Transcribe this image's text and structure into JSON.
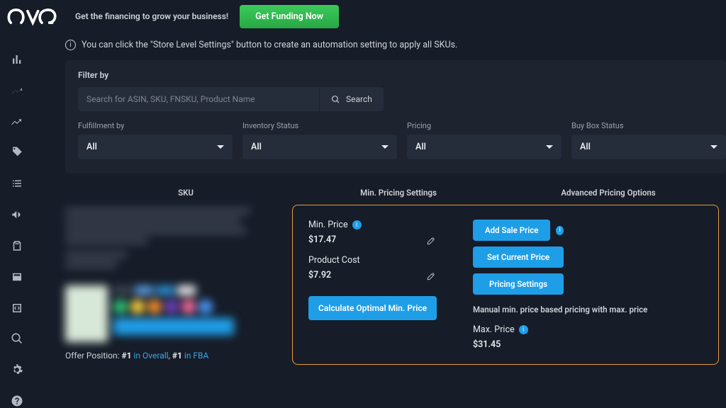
{
  "topbar": {
    "promo_text": "Get the financing to grow your business!",
    "funding_btn": "Get Funding Now"
  },
  "info_banner": "You can click the \"Store Level Settings\" button to create an automation setting to apply all SKUs.",
  "filter": {
    "title": "Filter by",
    "search_placeholder": "Search for ASIN, SKU, FNSKU, Product Name",
    "search_btn": "Search",
    "fulfillment": {
      "label": "Fulfillment by",
      "value": "All"
    },
    "inventory": {
      "label": "Inventory Status",
      "value": "All"
    },
    "pricing": {
      "label": "Pricing",
      "value": "All"
    },
    "buybox": {
      "label": "Buy Box Status",
      "value": "All"
    }
  },
  "table": {
    "head_sku": "SKU",
    "head_min": "Min. Pricing Settings",
    "head_adv": "Advanced Pricing Options"
  },
  "sku": {
    "offer_prefix": "Offer Position: ",
    "overall_rank": "#1",
    "overall_txt": " in Overall",
    "sep": ", ",
    "fba_rank": "#1",
    "fba_txt": " in FBA"
  },
  "pricing": {
    "min_price_label": "Min. Price",
    "min_price_value": "$17.47",
    "product_cost_label": "Product Cost",
    "product_cost_value": "$7.92",
    "calc_btn": "Calculate Optimal Min. Price",
    "add_sale_btn": "Add Sale Price",
    "set_current_btn": "Set Current Price",
    "settings_btn": "Pricing Settings",
    "desc": "Manual min. price based pricing with max. price",
    "max_price_label": "Max. Price",
    "max_price_value": "$31.45"
  }
}
